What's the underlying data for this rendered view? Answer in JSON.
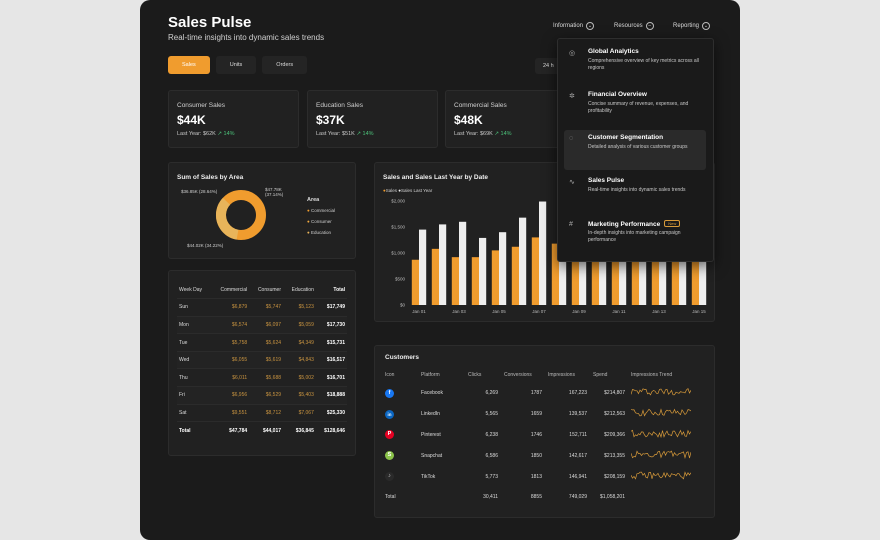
{
  "app": {
    "title": "Sales Pulse",
    "subtitle": "Real-time insights into dynamic sales trends"
  },
  "nav": [
    {
      "label": "Information",
      "icon": "chevron-down-icon"
    },
    {
      "label": "Resources",
      "icon": "minus-icon"
    },
    {
      "label": "Reporting",
      "icon": "chevron-down-icon"
    }
  ],
  "tabs": [
    "Sales",
    "Units",
    "Orders"
  ],
  "active_tab": "Sales",
  "date_filter": "24 h",
  "kpis": [
    {
      "label": "Consumer Sales",
      "value": "$44K",
      "last_year": "Last Year: $62K",
      "change": "↗ 14%"
    },
    {
      "label": "Education Sales",
      "value": "$37K",
      "last_year": "Last Year: $51K",
      "change": "↗ 14%"
    },
    {
      "label": "Commercial Sales",
      "value": "$48K",
      "last_year": "Last Year: $69K",
      "change": "↗ 14%"
    }
  ],
  "donut": {
    "title": "Sum of Sales by Area",
    "legend_title": "Area",
    "labels": [
      "$36.85K (28.64%)",
      "$47.78K (37.14%)",
      "$44.02K (34.22%)"
    ],
    "legend": [
      "Commercial",
      "Consumer",
      "Education"
    ],
    "colors": [
      "#f09c2e",
      "#f2a93f",
      "#e8b45a"
    ]
  },
  "weekday_table": {
    "headers": [
      "Week Day",
      "Commercial",
      "Consumer",
      "Education",
      "Total"
    ],
    "rows": [
      [
        "Sun",
        "$6,879",
        "$5,747",
        "$5,123",
        "$17,749"
      ],
      [
        "Mon",
        "$6,574",
        "$6,097",
        "$5,059",
        "$17,730"
      ],
      [
        "Tue",
        "$5,758",
        "$5,624",
        "$4,349",
        "$15,731"
      ],
      [
        "Wed",
        "$6,055",
        "$5,619",
        "$4,843",
        "$16,517"
      ],
      [
        "Thu",
        "$6,011",
        "$5,688",
        "$5,002",
        "$16,701"
      ],
      [
        "Fri",
        "$6,956",
        "$6,529",
        "$5,403",
        "$18,888"
      ],
      [
        "Sat",
        "$9,551",
        "$8,712",
        "$7,067",
        "$25,330"
      ]
    ],
    "total": [
      "Total",
      "$47,784",
      "$44,017",
      "$36,845",
      "$128,646"
    ]
  },
  "bar_chart": {
    "title": "Sales and Sales Last Year by Date",
    "legend": [
      "Sales",
      "Sales Last Year"
    ],
    "colors": {
      "sales": "#f09c2e",
      "last_year": "#eeeeee"
    },
    "y_ticks": [
      "$0",
      "$500",
      "$1,000",
      "$1,500",
      "$2,000"
    ],
    "x_ticks": [
      "Jan 01",
      "Jan 03",
      "Jan 05",
      "Jan 07",
      "Jan 09",
      "Jan 11",
      "Jan 13",
      "Jan 15"
    ]
  },
  "chart_data": {
    "type": "bar",
    "title": "Sales and Sales Last Year by Date",
    "categories": [
      "Jan 01",
      "Jan 02",
      "Jan 03",
      "Jan 04",
      "Jan 05",
      "Jan 06",
      "Jan 07",
      "Jan 08",
      "Jan 09",
      "Jan 10",
      "Jan 11",
      "Jan 12",
      "Jan 13",
      "Jan 14",
      "Jan 15"
    ],
    "series": [
      {
        "name": "Sales",
        "values": [
          870,
          1080,
          920,
          920,
          1050,
          1120,
          1300,
          1180,
          1000,
          960,
          1080,
          1000,
          1000,
          1000,
          1080
        ]
      },
      {
        "name": "Sales Last Year",
        "values": [
          1450,
          1550,
          1600,
          1290,
          1400,
          1680,
          1990,
          1780,
          1500,
          1450,
          1600,
          1500,
          1650,
          1600,
          1800
        ]
      }
    ],
    "ylim": [
      0,
      2000
    ],
    "xlabel": "",
    "ylabel": ""
  },
  "customers": {
    "title": "Customers",
    "headers": [
      "Icon",
      "Platform",
      "Clicks",
      "Conversions",
      "Impressions",
      "Spend",
      "Impressions Trend"
    ],
    "rows": [
      {
        "icon": "facebook-icon",
        "color": "#1877f2",
        "glyph": "f",
        "platform": "Facebook",
        "clicks": "6,269",
        "conv": "1787",
        "impr": "167,223",
        "spend": "$214,807"
      },
      {
        "icon": "linkedin-icon",
        "color": "#0a66c2",
        "glyph": "in",
        "platform": "LinkedIn",
        "clicks": "5,565",
        "conv": "1659",
        "impr": "139,537",
        "spend": "$212,563"
      },
      {
        "icon": "pinterest-icon",
        "color": "#e60023",
        "glyph": "P",
        "platform": "Pinterest",
        "clicks": "6,238",
        "conv": "1746",
        "impr": "152,711",
        "spend": "$209,366"
      },
      {
        "icon": "snapchat-icon",
        "color": "#8bc34a",
        "glyph": "S",
        "platform": "Snapchat",
        "clicks": "6,586",
        "conv": "1850",
        "impr": "142,617",
        "spend": "$213,355"
      },
      {
        "icon": "tiktok-icon",
        "color": "#2a2a2a",
        "glyph": "♪",
        "platform": "TikTok",
        "clicks": "5,773",
        "conv": "1813",
        "impr": "146,941",
        "spend": "$208,159"
      }
    ],
    "total": {
      "label": "Total",
      "clicks": "30,411",
      "conv": "8855",
      "impr": "749,029",
      "spend": "$1,058,201"
    }
  },
  "dropdown": [
    {
      "title": "Global Analytics",
      "desc": "Comprehensive overview of key metrics across all regions",
      "icon": "globe-icon",
      "glyph": "◎"
    },
    {
      "title": "Financial Overview",
      "desc": "Concise summary of revenue, expenses, and profitability",
      "icon": "gear-icon",
      "glyph": "✲"
    },
    {
      "title": "Customer Segmentation",
      "desc": "Detailed analysis of various customer groups",
      "icon": "pin-icon",
      "glyph": "◌"
    },
    {
      "title": "Sales Pulse",
      "desc": "Real-time insights into dynamic sales trends",
      "icon": "pulse-icon",
      "glyph": "∿"
    },
    {
      "title": "Marketing Performance",
      "desc": "In-depth insights into marketing campaign performance",
      "icon": "hash-icon",
      "glyph": "#",
      "badge": "New"
    }
  ]
}
